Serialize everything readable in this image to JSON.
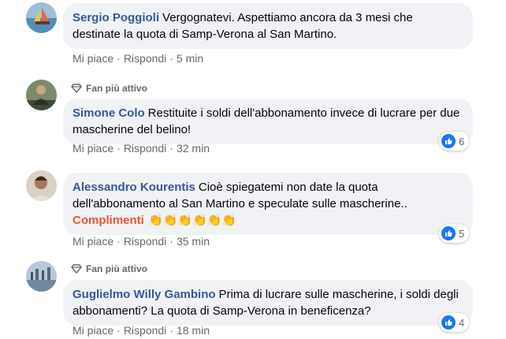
{
  "labels": {
    "like": "Mi piace",
    "reply": "Rispondi",
    "separator": "·"
  },
  "colors": {
    "author": "#385898",
    "bubble": "#f0f2f5",
    "meta": "#65676b",
    "like_blue": "#1877f2",
    "complimenti": "#e8572c"
  },
  "comments": [
    {
      "author": "Sergio Poggioli",
      "text": "Vergognatevi. Aspettiamo ancora da 3 mesi che destinate la quota di Samp-Verona al San Martino.",
      "time": "5 min",
      "badge": "",
      "reactions": ""
    },
    {
      "author": "Simone Colo",
      "text": "Restituite i soldi dell'abbonamento invece di lucrare per due mascherine del belino!",
      "time": "32 min",
      "badge": "Fan più attivo",
      "reactions": "6"
    },
    {
      "author": "Alessandro Kourentis",
      "text": "Cioè spiegatemi non date la quota dell'abbonamento al San Martino e speculate sulle mascherine..",
      "extra": "Complimenti",
      "emoji": "👏👏👏👏👏👏",
      "time": "35 min",
      "badge": "",
      "reactions": "5"
    },
    {
      "author": "Guglielmo Willy Gambino",
      "text": "Prima di lucrare sulle mascherine, i soldi degli abbonamenti? La quota di Samp-Verona in beneficenza?",
      "time": "18 min",
      "badge": "Fan più attivo",
      "reactions": "4"
    }
  ]
}
